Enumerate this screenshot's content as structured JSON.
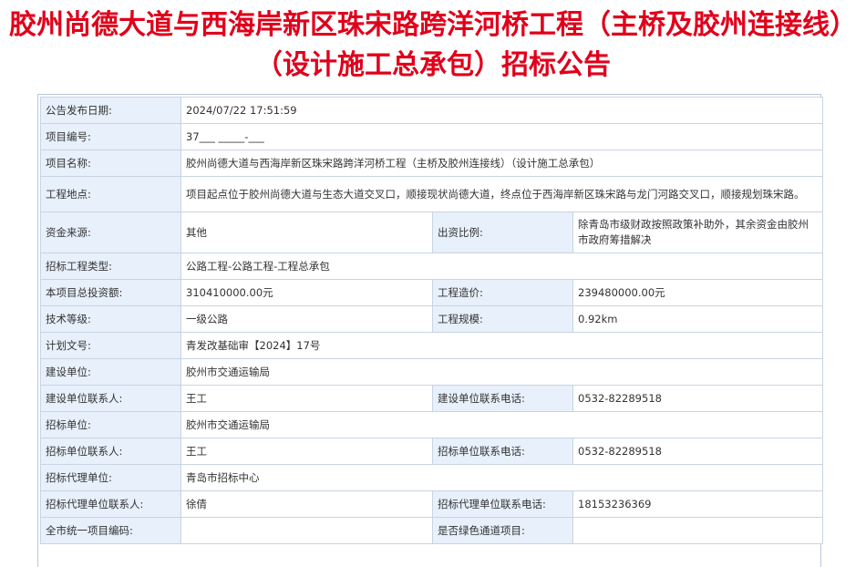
{
  "title": "胶州尚德大道与西海岸新区珠宋路跨洋河桥工程（主桥及胶州连接线）（设计施工总承包）招标公告",
  "rows": {
    "publish_date": {
      "label": "公告发布日期:",
      "value": "2024/07/22 17:51:59"
    },
    "project_no": {
      "label": "项目编号:",
      "value": "37___ _____-___"
    },
    "project_name": {
      "label": "项目名称:",
      "value": "胶州尚德大道与西海岸新区珠宋路跨洋河桥工程（主桥及胶州连接线）（设计施工总承包）"
    },
    "location": {
      "label": "工程地点:",
      "value": "项目起点位于胶州尚德大道与生态大道交叉口，顺接现状尚德大道，终点位于西海岸新区珠宋路与龙门河路交叉口，顺接规划珠宋路。"
    },
    "fund_source": {
      "label": "资金来源:",
      "value": "其他",
      "label2": "出资比例:",
      "value2": "除青岛市级财政按照政策补助外，其余资金由胶州市政府筹措解决"
    },
    "tender_type": {
      "label": "招标工程类型:",
      "value": "公路工程-公路工程-工程总承包"
    },
    "total_invest": {
      "label": "本项目总投资额:",
      "value": "310410000.00元",
      "label2": "工程造价:",
      "value2": "239480000.00元"
    },
    "tech_grade": {
      "label": "技术等级:",
      "value": "一级公路",
      "label2": "工程规模:",
      "value2": "0.92km"
    },
    "plan_doc": {
      "label": "计划文号:",
      "value": "青发改基础审【2024】17号"
    },
    "build_unit": {
      "label": "建设单位:",
      "value": "胶州市交通运输局"
    },
    "build_contact": {
      "label": "建设单位联系人:",
      "value": "王工",
      "label2": "建设单位联系电话:",
      "value2": "0532-82289518"
    },
    "tender_unit": {
      "label": "招标单位:",
      "value": "胶州市交通运输局"
    },
    "tender_contact": {
      "label": "招标单位联系人:",
      "value": "王工",
      "label2": "招标单位联系电话:",
      "value2": "0532-82289518"
    },
    "agent_unit": {
      "label": "招标代理单位:",
      "value": "青岛市招标中心"
    },
    "agent_contact": {
      "label": "招标代理单位联系人:",
      "value": "徐倩",
      "label2": "招标代理单位联系电话:",
      "value2": "18153236369"
    },
    "unified_code": {
      "label": "全市统一项目编码:",
      "value": "",
      "label2": "是否绿色通道项目:",
      "value2": ""
    }
  }
}
